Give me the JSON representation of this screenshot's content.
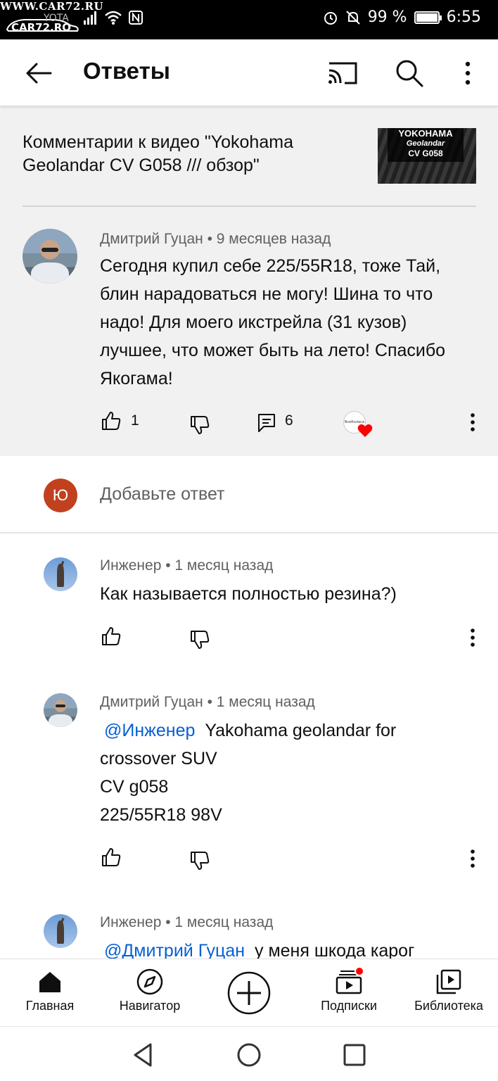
{
  "status_bar": {
    "watermark_top": "WWW.CAR72.RU",
    "watermark_logo": "CAR72.RO",
    "carrier": "YOTA",
    "battery": "99 %",
    "time": "6:55",
    "battery_level": 0.99
  },
  "app_bar": {
    "title": "Ответы",
    "back_icon": "arrow-left-icon",
    "cast_icon": "cast-icon",
    "search_icon": "search-icon",
    "more_icon": "more-vertical-icon"
  },
  "video_ref": {
    "text": "Комментарии к видео \"Yokohama Geolandar CV G058 /// обзор\"",
    "thumb_line1": "YOKOHAMA",
    "thumb_line2": "Geolandar",
    "thumb_line3": "CV G058"
  },
  "parent_comment": {
    "author": "Дмитрий Гуцан",
    "time": "9 месяцев назад",
    "text": "Сегодня купил себе 225/55R18, тоже Тай, блин нарадоваться не могу! Шина то что надо! Для моего икстрейла (31 кузов) лучшее, что может быть на лето! Спасибо Якогама!",
    "likes": "1",
    "replies": "6",
    "creator_avatar_text": "ВсеКолеса"
  },
  "add_reply": {
    "avatar_letter": "Ю",
    "placeholder": "Добавьте ответ"
  },
  "replies": [
    {
      "author": "Инженер",
      "time": "1 месяц назад",
      "text": "Как называется полностью резина?)"
    },
    {
      "author": "Дмитрий Гуцан",
      "time": "1 месяц назад",
      "mention": "@Инженер",
      "text_line1": "Yakohama geolandar for",
      "text_line2": "crossover SUV",
      "text_line3": "CV g058",
      "text_line4": "225/55R18 98V"
    },
    {
      "author": "Инженер",
      "time": "1 месяц назад",
      "mention": "@Дмитрий Гуцан",
      "text": "у меня шкода карог"
    }
  ],
  "bottom_nav": {
    "items": [
      {
        "label": "Главная",
        "icon": "home-icon"
      },
      {
        "label": "Навигатор",
        "icon": "compass-icon"
      },
      {
        "label": "Подписки",
        "icon": "subscriptions-icon"
      },
      {
        "label": "Библиотека",
        "icon": "library-icon"
      }
    ],
    "create_icon": "add-circle-icon"
  },
  "system_nav": {
    "back_icon": "triangle-back-icon",
    "home_icon": "circle-home-icon",
    "recents_icon": "square-recents-icon"
  }
}
